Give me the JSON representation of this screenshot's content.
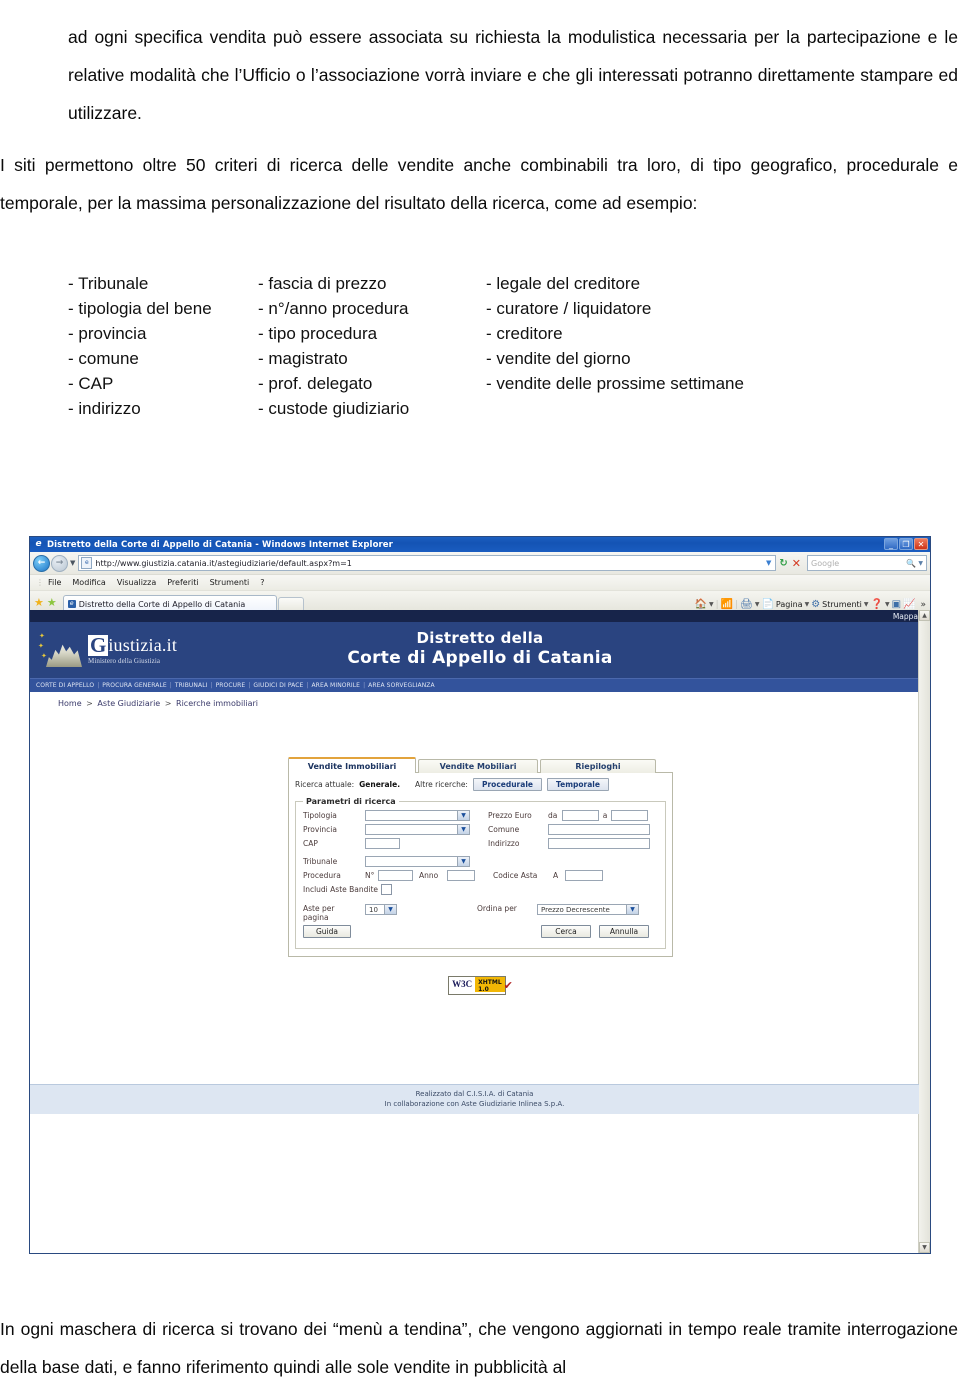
{
  "document": {
    "paragraph1": "ad ogni specifica vendita può essere associata su richiesta la modulistica necessaria per la partecipazione e le relative modalità che l’Ufficio o l’associazione vorrà inviare e che gli interessati potranno direttamente stampare ed utilizzare.",
    "paragraph2": "I siti permettono oltre 50 criteri di ricerca delle vendite anche combinabili tra loro, di tipo geografico, procedurale e temporale, per la massima personalizzazione del risultato della ricerca, come ad esempio:",
    "paragraph3": "In ogni maschera di ricerca si trovano dei “menù a tendina”, che vengono aggiornati in tempo reale tramite interrogazione della base dati, e fanno riferimento quindi alle sole vendite in pubblicità al",
    "criteria_columns": [
      [
        "- Tribunale",
        "- tipologia del bene",
        "- provincia",
        "- comune",
        "- CAP",
        "- indirizzo"
      ],
      [
        "- fascia di prezzo",
        "- n°/anno procedura",
        "- tipo procedura",
        "- magistrato",
        "- prof. delegato",
        "- custode giudiziario"
      ],
      [
        "- legale del creditore",
        "- curatore / liquidatore",
        "- creditore",
        "- vendite del giorno",
        "- vendite delle prossime settimane"
      ]
    ]
  },
  "browser": {
    "title": "Distretto della Corte di Appello di Catania - Windows Internet Explorer",
    "window_buttons": {
      "minimize": "_",
      "maximize": "❐",
      "close": "✕"
    },
    "url": "http://www.giustizia.catania.it/astegiudiziarie/default.aspx?m=1",
    "search_placeholder": "Google",
    "menu_items": [
      "File",
      "Modifica",
      "Visualizza",
      "Preferiti",
      "Strumenti",
      "?"
    ],
    "tab_label": "Distretto della Corte di Appello di Catania",
    "command_bar": [
      "Pagina",
      "Strumenti"
    ],
    "overflow": "»"
  },
  "site": {
    "mappa": "Mappa",
    "logo": {
      "initial": "G",
      "rest": "iustizia.it",
      "subtitle": "Ministero della Giustizia"
    },
    "title_line1": "Distretto della",
    "title_line2": "Corte di Appello di Catania",
    "nav_items": [
      "CORTE DI APPELLO",
      "PROCURA GENERALE",
      "TRIBUNALI",
      "PROCURE",
      "GIUDICI DI PACE",
      "AREA MINORILE",
      "AREA SORVEGLIANZA"
    ],
    "breadcrumb": {
      "home": "Home",
      "level2": "Aste Giudiziarie",
      "level3": "Ricerche immobiliari",
      "separator": ">"
    },
    "footer_line1": "Realizzato dal C.I.S.I.A. di Catania",
    "footer_line2": "In collaborazione con Aste Giudiziarie Inlinea S.p.A.",
    "w3c": {
      "left": "W3C",
      "right_line1": "XHTML",
      "right_line2": "1.0",
      "check": "✔"
    }
  },
  "form": {
    "tabs": [
      {
        "label": "Vendite Immobiliari",
        "active": true
      },
      {
        "label": "Vendite Mobiliari",
        "active": false
      },
      {
        "label": "Riepiloghi",
        "active": false
      }
    ],
    "current_search_label": "Ricerca attuale:",
    "current_search_value": "Generale.",
    "other_searches_label": "Altre ricerche:",
    "other_searches": [
      "Procedurale",
      "Temporale"
    ],
    "legend": "Parametri di ricerca",
    "fields": {
      "tipologia": {
        "label": "Tipologia",
        "value": ""
      },
      "prezzo_euro": {
        "label": "Prezzo Euro",
        "da_label": "da",
        "da_value": "",
        "a_label": "a",
        "a_value": ""
      },
      "provincia": {
        "label": "Provincia",
        "value": ""
      },
      "comune": {
        "label": "Comune",
        "value": ""
      },
      "cap": {
        "label": "CAP",
        "value": ""
      },
      "indirizzo": {
        "label": "Indirizzo",
        "value": ""
      },
      "tribunale": {
        "label": "Tribunale",
        "value": ""
      },
      "procedura": {
        "label": "Procedura",
        "n_label": "N°",
        "n_value": "",
        "anno_label": "Anno",
        "anno_value": ""
      },
      "codice_asta": {
        "label": "Codice Asta",
        "a_label": "A",
        "value": ""
      },
      "includi_aste_bandite": {
        "label": "Includi Aste Bandite",
        "checked": false
      },
      "aste_per_pagina": {
        "label": "Aste per pagina",
        "value": "10"
      },
      "ordina_per": {
        "label": "Ordina per",
        "value": "Prezzo Decrescente"
      }
    },
    "buttons": {
      "guida": "Guida",
      "cerca": "Cerca",
      "annulla": "Annulla"
    }
  },
  "colors": {
    "header_blue": "#2a4480",
    "nav_blue": "#33539c",
    "mappa_bar": "#17244a",
    "tab_accent": "#e2a33c",
    "footer_bg": "#dde6f2",
    "titlebar": "#1453b4"
  }
}
